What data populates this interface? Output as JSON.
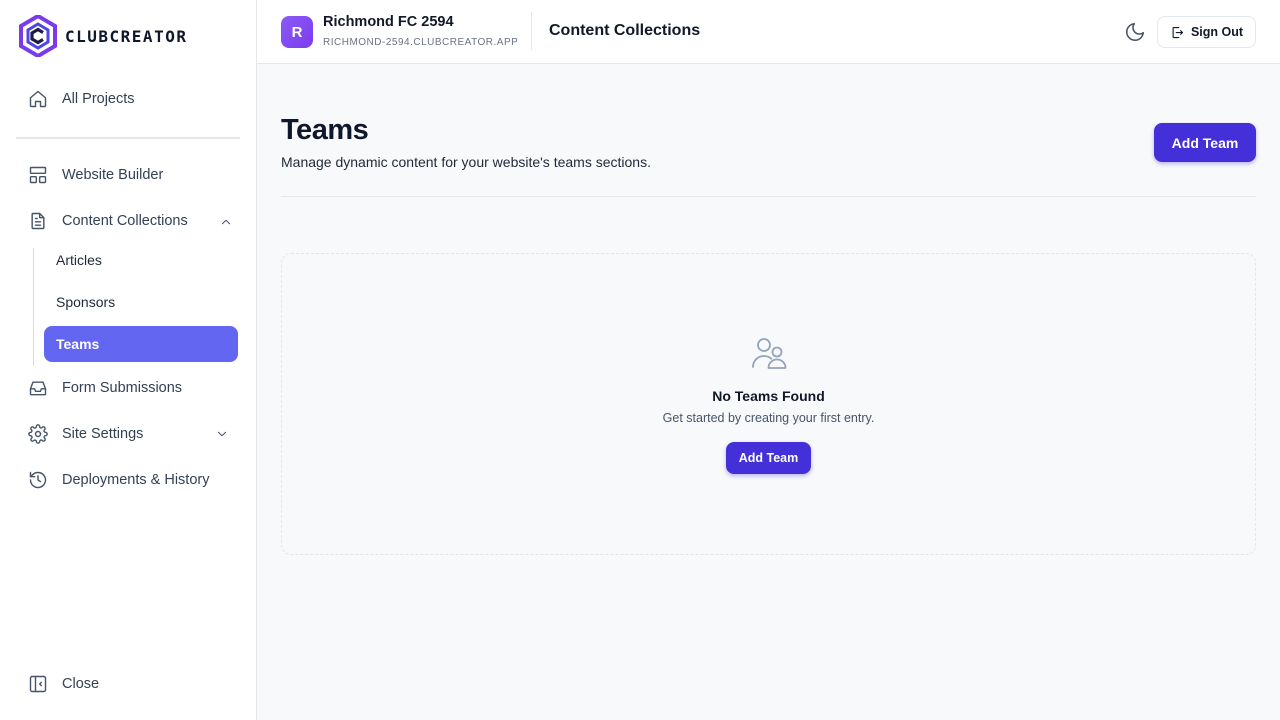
{
  "brand": {
    "name": "CLUBCREATOR"
  },
  "sidebar": {
    "all_projects": "All Projects",
    "website_builder": "Website Builder",
    "content_collections": "Content Collections",
    "sub_items": [
      "Articles",
      "Sponsors",
      "Teams"
    ],
    "active_sub": "Teams",
    "form_submissions": "Form Submissions",
    "site_settings": "Site Settings",
    "deployments": "Deployments & History",
    "close": "Close"
  },
  "header": {
    "avatar_letter": "R",
    "project_name": "Richmond FC 2594",
    "project_domain": "RICHMOND-2594.CLUBCREATOR.APP",
    "section_title": "Content Collections",
    "sign_out": "Sign Out"
  },
  "main": {
    "title": "Teams",
    "subtitle": "Manage dynamic content for your website's teams sections.",
    "add_button": "Add Team",
    "empty": {
      "title": "No Teams Found",
      "subtitle": "Get started by creating your first entry.",
      "button": "Add Team"
    }
  },
  "colors": {
    "primary": "#4330d8",
    "active_nav": "#6366f1",
    "avatar": "#7c3aed",
    "logo": "#6d28d9"
  },
  "icons": [
    "home-icon",
    "layout-icon",
    "document-icon",
    "inbox-icon",
    "gear-icon",
    "history-icon",
    "sidebar-collapse-icon",
    "moon-icon",
    "sign-out-icon",
    "users-icon",
    "chevron-up-icon",
    "chevron-down-icon"
  ]
}
